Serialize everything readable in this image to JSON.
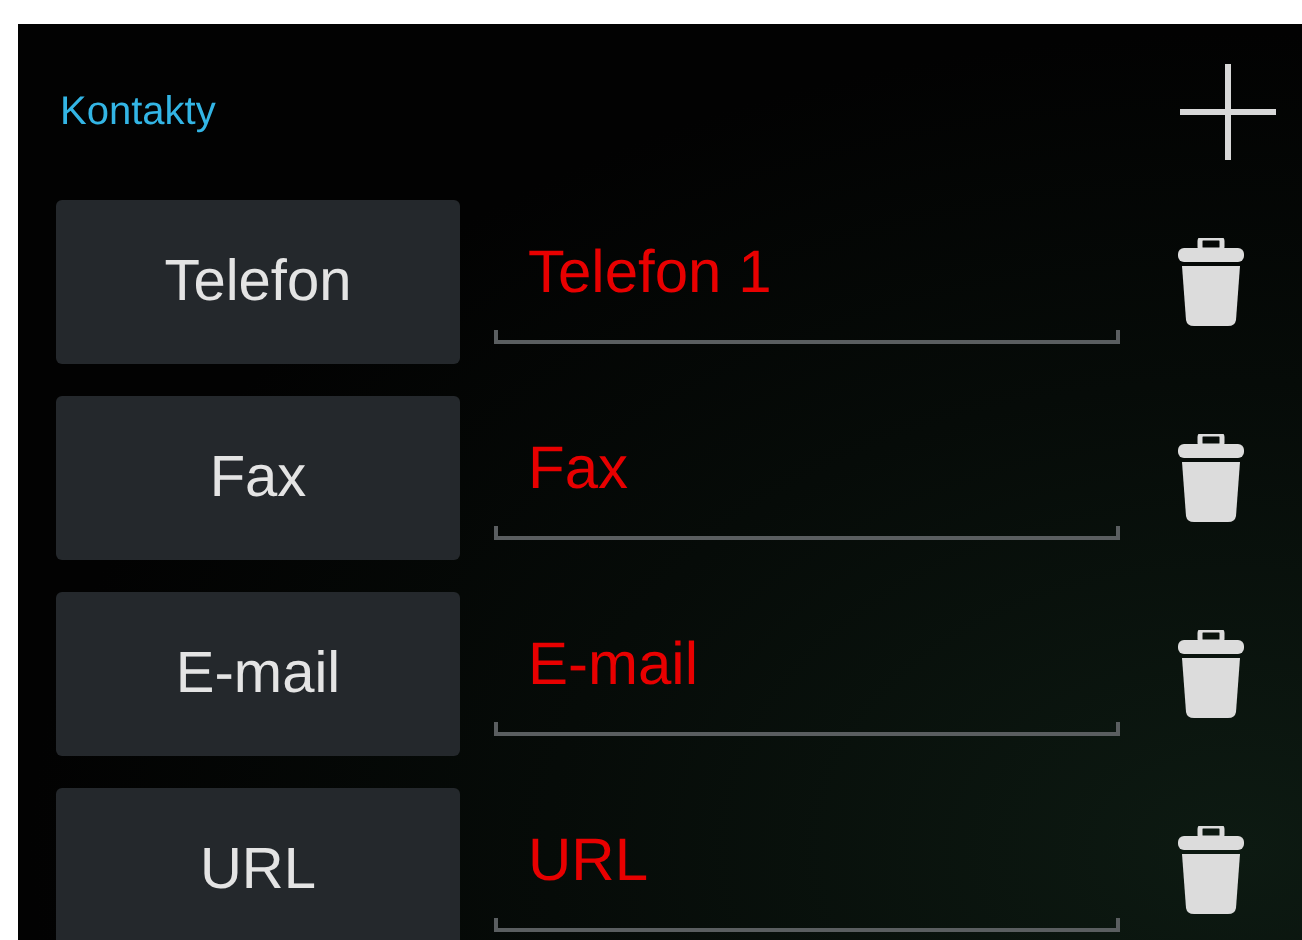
{
  "header": {
    "title": "Kontakty"
  },
  "contacts": [
    {
      "type_button": "Telefon",
      "field": {
        "placeholder": "Telefon 1"
      }
    },
    {
      "type_button": "Fax",
      "field": {
        "placeholder": "Fax"
      }
    },
    {
      "type_button": "E-mail",
      "field": {
        "placeholder": "E-mail"
      }
    },
    {
      "type_button": "URL",
      "field": {
        "placeholder": "URL"
      }
    }
  ]
}
